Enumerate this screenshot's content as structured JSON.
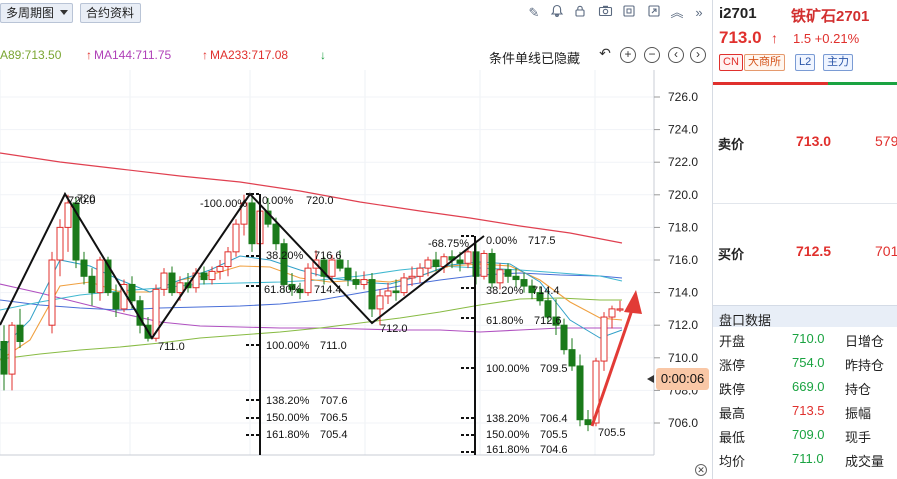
{
  "toolbar": {
    "period_label": "多周期图",
    "contract_label": "合约资料"
  },
  "ma_legend": {
    "ma89": "A89:713.50",
    "ma144": "MA144:711.75",
    "ma233": "MA233:717.08",
    "condition_text": "条件单线已隐藏"
  },
  "chart": {
    "y_ticks": [
      "726.0",
      "724.0",
      "722.0",
      "720.0",
      "718.0",
      "716.0",
      "714.0",
      "712.0",
      "710.0",
      "708.0",
      "706.0"
    ],
    "time_badge": "0:00:06",
    "annotations": {
      "peak1": "720",
      "peak1b": "720.0",
      "low1": "711.0",
      "neg100": "-100.00%",
      "pct0_a": "0.00%",
      "val720": "720.0",
      "pct38_a": "38.20%",
      "val7166": "716.6",
      "pct618_a": "61.80%",
      "val7144_a": "714.4",
      "pct100_a": "100.00%",
      "val711": "711.0",
      "pct1382_a": "138.20%",
      "val7076": "707.6",
      "pct150_a": "150.00%",
      "val7065": "706.5",
      "pct1618_a": "161.80%",
      "val7054": "705.4",
      "low2": "712.0",
      "neg6875": "-68.75%",
      "pct0_b": "0.00%",
      "val7175": "717.5",
      "pct38_b": "38.20%",
      "val7144_b": "714.4",
      "pct618_b": "61.80%",
      "val7126": "712.6",
      "pct100_b": "100.00%",
      "val7095": "709.5",
      "pct1382_b": "138.20%",
      "val7064": "706.4",
      "pct150_b": "150.00%",
      "val7055": "705.5",
      "pct1618_b": "161.80%",
      "val7046": "704.6",
      "low3": "705.5"
    },
    "colors": {
      "up": "#e0302d",
      "down": "#1a7a1a",
      "ma233": "#e04050",
      "ma144": "#b050c0",
      "ma89": "#88bb44"
    }
  },
  "panel": {
    "code": "i2701",
    "name": "铁矿石2701",
    "last": "713.0",
    "change": "1.5 +0.21%",
    "tags": [
      "CN",
      "大商所",
      "L2",
      "主力"
    ],
    "ask_label": "卖价",
    "ask_price": "713.0",
    "ask_vol": "579",
    "bid_label": "买价",
    "bid_price": "712.5",
    "bid_vol": "701",
    "disk_title": "盘口数据",
    "stats": [
      {
        "label": "开盘",
        "value": "710.0",
        "label2": "日增仓"
      },
      {
        "label": "涨停",
        "value": "754.0",
        "label2": "昨持仓"
      },
      {
        "label": "跌停",
        "value": "669.0",
        "label2": "持仓"
      },
      {
        "label": "最高",
        "value": "713.5",
        "label2": "振幅"
      },
      {
        "label": "最低",
        "value": "709.0",
        "label2": "现手"
      },
      {
        "label": "均价",
        "value": "711.0",
        "label2": "成交量"
      }
    ]
  }
}
